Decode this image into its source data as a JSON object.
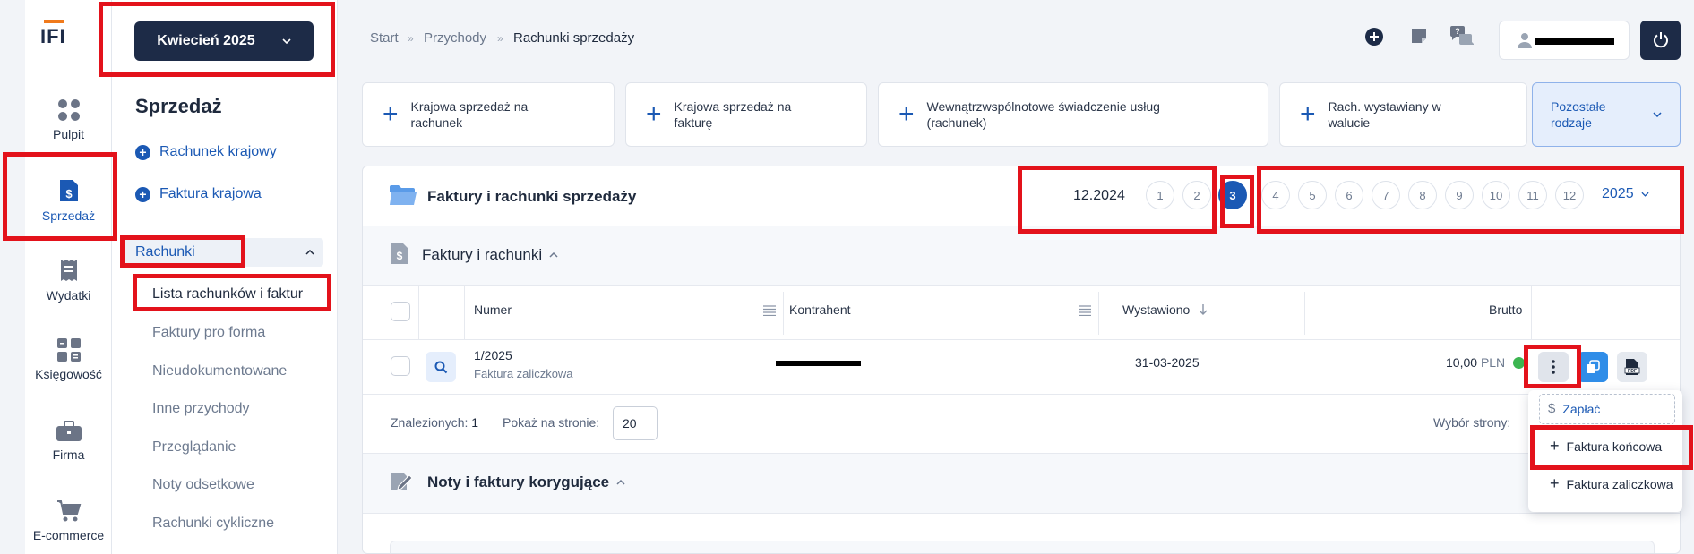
{
  "logo": "IFI",
  "rail": [
    {
      "label": "Pulpit",
      "icon": "dashboard-icon"
    },
    {
      "label": "Sprzedaż",
      "icon": "invoice-icon"
    },
    {
      "label": "Wydatki",
      "icon": "receipt-icon"
    },
    {
      "label": "Księgowość",
      "icon": "calculator-icon"
    },
    {
      "label": "Firma",
      "icon": "briefcase-icon"
    },
    {
      "label": "E-commerce",
      "icon": "cart-icon"
    }
  ],
  "month_selector": "Kwiecień 2025",
  "subnav": {
    "title": "Sprzedaż",
    "add_links": [
      "Rachunek krajowy",
      "Faktura krajowa"
    ],
    "group": "Rachunki",
    "items": [
      "Lista rachunków i faktur",
      "Faktury pro forma",
      "Nieudokumentowane",
      "Inne przychody",
      "Przeglądanie",
      "Noty odsetkowe",
      "Rachunki cykliczne"
    ]
  },
  "breadcrumb": [
    "Start",
    "Przychody",
    "Rachunki sprzedaży"
  ],
  "quick_cards": [
    "Krajowa sprzedaż na rachunek",
    "Krajowa sprzedaż na fakturę",
    "Wewnątrzwspólnotowe  świadczenie usług (rachunek)",
    "Rach. wystawiany w walucie"
  ],
  "other_types": "Pozostałe rodzaje",
  "panel": {
    "title": "Faktury i rachunki sprzedaży",
    "prev_period": "12.2024",
    "pages": [
      "1",
      "2",
      "3",
      "4",
      "5",
      "6",
      "7",
      "8",
      "9",
      "10",
      "11",
      "12"
    ],
    "active_page": "3",
    "year": "2025",
    "section_title": "Faktury i rachunki",
    "columns": {
      "number": "Numer",
      "contractor": "Kontrahent",
      "issued": "Wystawiono",
      "gross": "Brutto"
    },
    "row": {
      "number": "1/2025",
      "type": "Faktura zaliczkowa",
      "issued": "31-03-2025",
      "gross": "10,00",
      "currency": "PLN"
    },
    "found_label": "Znalezionych:",
    "found_count": "1",
    "per_page_label": "Pokaż na stronie:",
    "per_page": "20",
    "page_select_label": "Wybór strony:",
    "corrections_title": "Noty i faktury korygujące"
  },
  "dropdown": [
    "Zapłać",
    "Faktura końcowa",
    "Faktura zaliczkowa"
  ],
  "colors": {
    "accent": "#1b59b4",
    "dark": "#1d2b47",
    "highlight": "#e3121b",
    "status": "#3cb550"
  }
}
